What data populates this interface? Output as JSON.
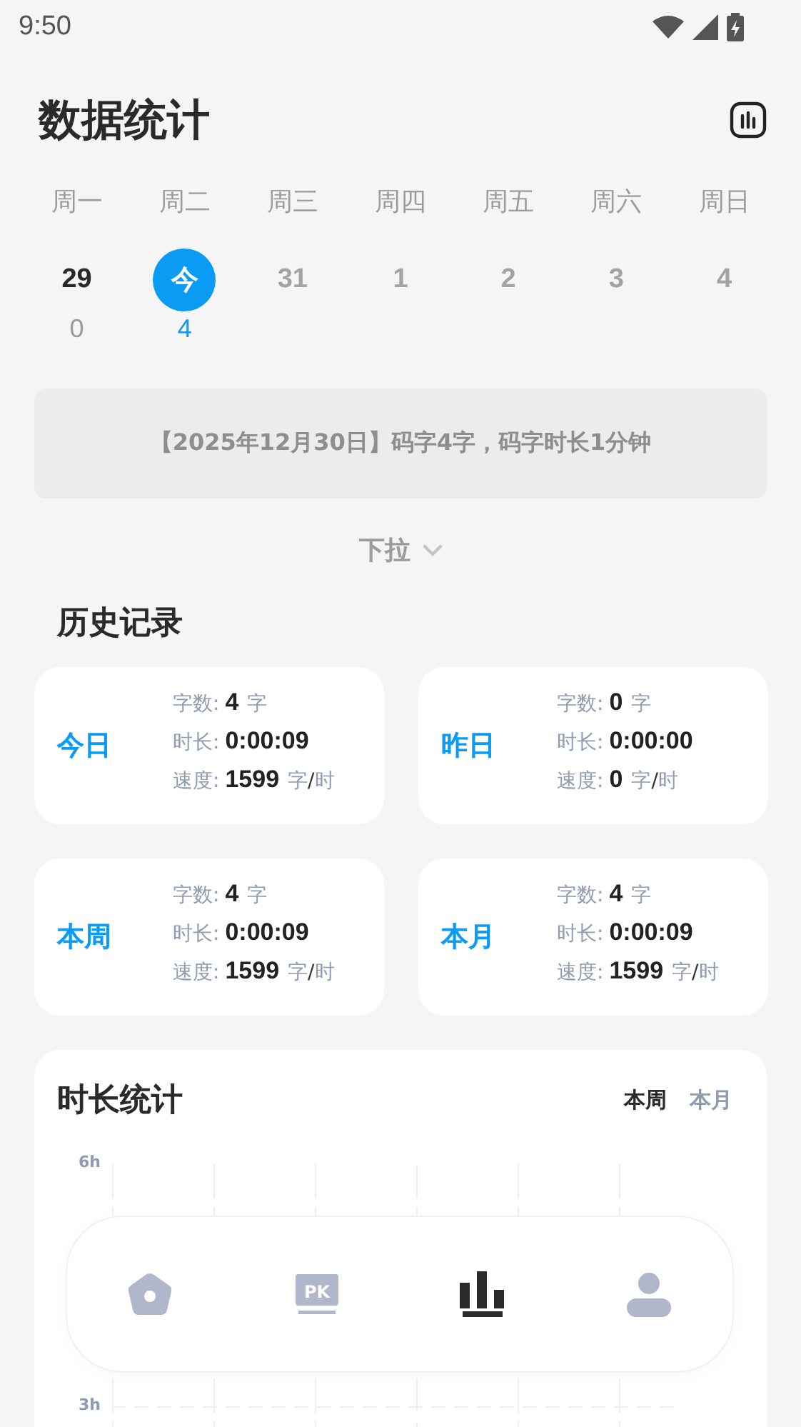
{
  "status_bar": {
    "time": "9:50"
  },
  "header": {
    "title": "数据统计"
  },
  "week": {
    "days": [
      {
        "weekday": "周一",
        "date": "29",
        "count": "0",
        "selected": false,
        "kind": "past"
      },
      {
        "weekday": "周二",
        "date": "今",
        "count": "4",
        "selected": true,
        "kind": "past"
      },
      {
        "weekday": "周三",
        "date": "31",
        "selected": false,
        "kind": "future"
      },
      {
        "weekday": "周四",
        "date": "1",
        "selected": false,
        "kind": "future"
      },
      {
        "weekday": "周五",
        "date": "2",
        "selected": false,
        "kind": "future"
      },
      {
        "weekday": "周六",
        "date": "3",
        "selected": false,
        "kind": "future"
      },
      {
        "weekday": "周日",
        "date": "4",
        "selected": false,
        "kind": "future"
      }
    ]
  },
  "summary": "【2025年12月30日】码字4字，码字时长1分钟",
  "pull_down": "下拉",
  "history": {
    "title": "历史记录",
    "cards": [
      {
        "period": "今日",
        "rows": [
          {
            "label": "字数:",
            "value": "4",
            "unit": "字"
          },
          {
            "label": "时长:",
            "value": "0:00:09"
          },
          {
            "label": "速度:",
            "value": "1599",
            "unit": "字",
            "sep": "/",
            "unit2": "时"
          }
        ]
      },
      {
        "period": "昨日",
        "rows": [
          {
            "label": "字数:",
            "value": "0",
            "unit": "字"
          },
          {
            "label": "时长:",
            "value": "0:00:00"
          },
          {
            "label": "速度:",
            "value": "0",
            "unit": "字",
            "sep": "/",
            "unit2": "时"
          }
        ]
      },
      {
        "period": "本周",
        "rows": [
          {
            "label": "字数:",
            "value": "4",
            "unit": "字"
          },
          {
            "label": "时长:",
            "value": "0:00:09"
          },
          {
            "label": "速度:",
            "value": "1599",
            "unit": "字",
            "sep": "/",
            "unit2": "时"
          }
        ]
      },
      {
        "period": "本月",
        "rows": [
          {
            "label": "字数:",
            "value": "4",
            "unit": "字"
          },
          {
            "label": "时长:",
            "value": "0:00:09"
          },
          {
            "label": "速度:",
            "value": "1599",
            "unit": "字",
            "sep": "/",
            "unit2": "时"
          }
        ]
      }
    ]
  },
  "duration": {
    "title": "时长统计",
    "tabs": [
      {
        "label": "本周",
        "selected": true
      },
      {
        "label": "本月",
        "selected": false
      }
    ],
    "y_labels": [
      "6h",
      "3h"
    ]
  },
  "bottom_nav": [
    {
      "kind": "home",
      "selected": false
    },
    {
      "kind": "pk",
      "icon_text": "PK",
      "selected": false
    },
    {
      "kind": "stats",
      "selected": true
    },
    {
      "kind": "profile",
      "selected": false
    }
  ]
}
